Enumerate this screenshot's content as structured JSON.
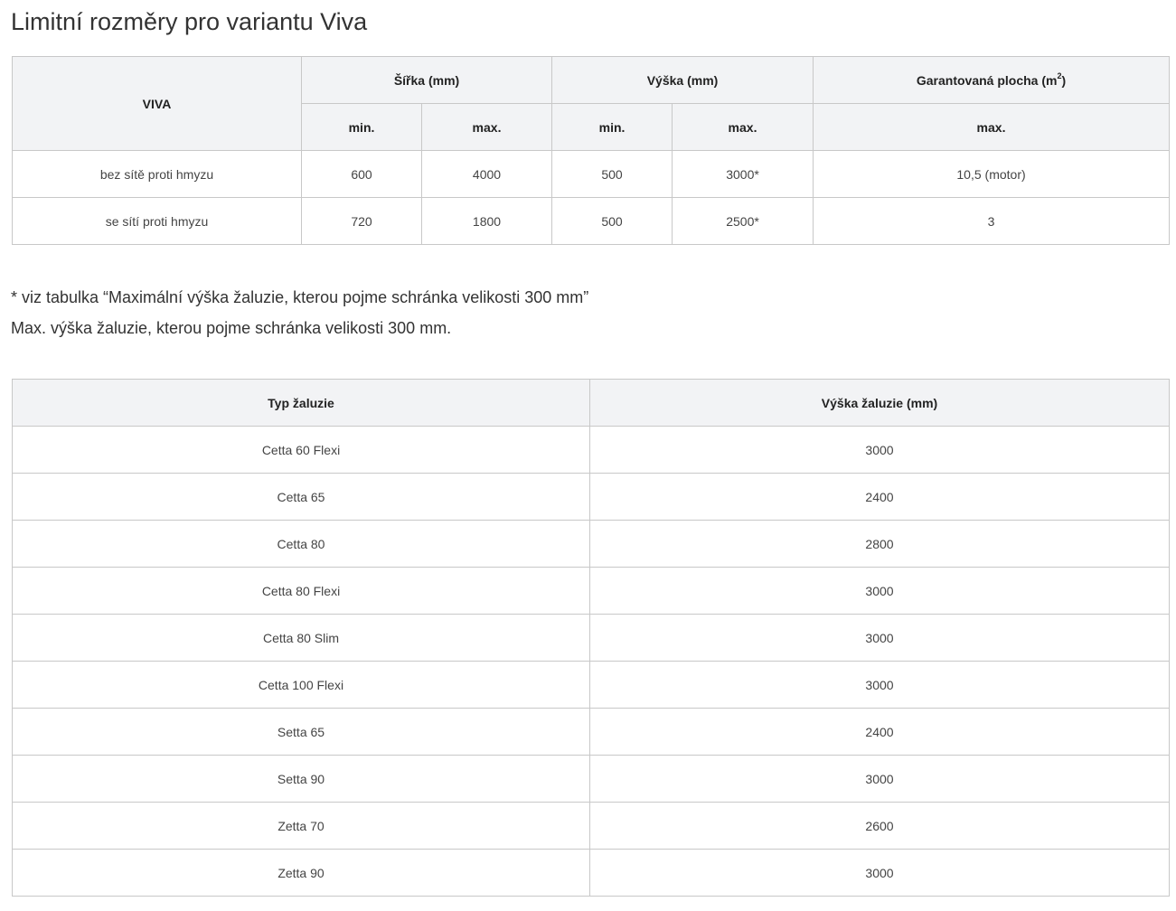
{
  "title": "Limitní rozměry pro variantu Viva",
  "limits_table": {
    "corner_label": "VIVA",
    "groups": {
      "width": "Šířka (mm)",
      "height": "Výška (mm)",
      "area_label": "Garantovaná plocha (m",
      "area_superscript": "2",
      "area_suffix": ")"
    },
    "subheaders": {
      "width_min": "min.",
      "width_max": "max.",
      "height_min": "min.",
      "height_max": "max.",
      "area_max": "max."
    },
    "rows": [
      {
        "label": "bez sítě proti hmyzu",
        "width_min": "600",
        "width_max": "4000",
        "height_min": "500",
        "height_max": "3000*",
        "area_max": "10,5 (motor)"
      },
      {
        "label": "se sítí proti hmyzu",
        "width_min": "720",
        "width_max": "1800",
        "height_min": "500",
        "height_max": "2500*",
        "area_max": "3"
      }
    ]
  },
  "notes": {
    "footnote": "* viz tabulka “Maximální výška žaluzie, kterou pojme schránka velikosti 300 mm”",
    "subtitle": "Max. výška žaluzie, kterou pojme schránka velikosti 300 mm."
  },
  "heights_table": {
    "headers": {
      "type": "Typ žaluzie",
      "height": "Výška žaluzie (mm)"
    },
    "rows": [
      {
        "type": "Cetta 60 Flexi",
        "height": "3000"
      },
      {
        "type": "Cetta 65",
        "height": "2400"
      },
      {
        "type": "Cetta 80",
        "height": "2800"
      },
      {
        "type": "Cetta 80 Flexi",
        "height": "3000"
      },
      {
        "type": "Cetta 80 Slim",
        "height": "3000"
      },
      {
        "type": "Cetta 100 Flexi",
        "height": "3000"
      },
      {
        "type": "Setta 65",
        "height": "2400"
      },
      {
        "type": "Setta 90",
        "height": "3000"
      },
      {
        "type": "Zetta 70",
        "height": "2600"
      },
      {
        "type": "Zetta 90",
        "height": "3000"
      }
    ]
  },
  "colors": {
    "header_background": "#f2f3f5",
    "border": "#c8c8c8",
    "text": "#333333"
  }
}
